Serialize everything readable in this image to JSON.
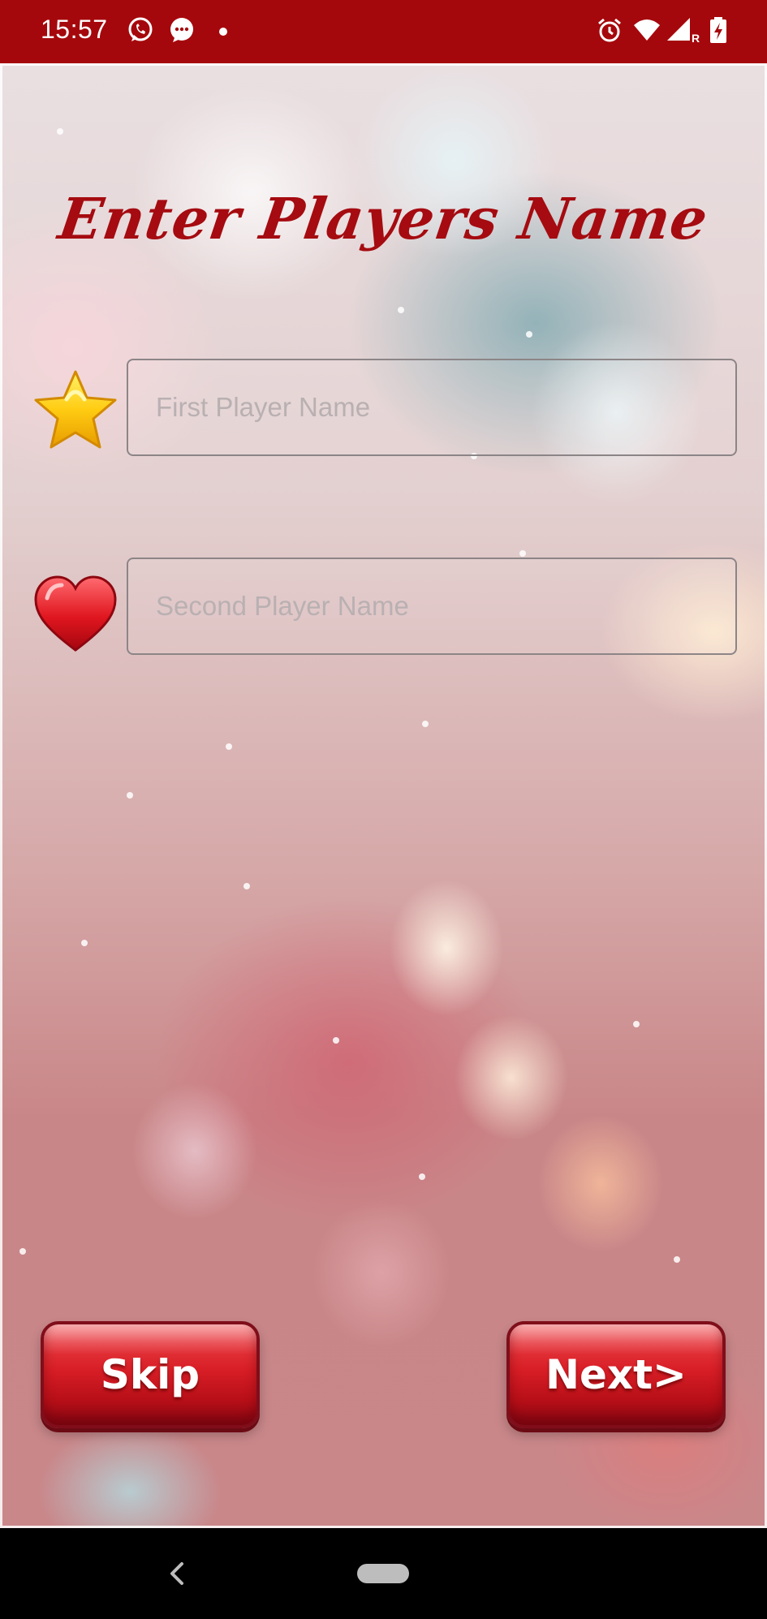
{
  "status_bar": {
    "time": "15:57",
    "left_icons": [
      "whatsapp-icon",
      "message-icon",
      "notification-dot-icon"
    ],
    "right_icons": [
      "alarm-icon",
      "wifi-icon",
      "signal-icon",
      "battery-charging-icon"
    ],
    "signal_label": "R"
  },
  "screen": {
    "title": "Enter Players Name",
    "first_player": {
      "icon": "star-icon",
      "value": "",
      "placeholder": "First Player Name"
    },
    "second_player": {
      "icon": "heart-icon",
      "value": "",
      "placeholder": "Second Player Name"
    },
    "buttons": {
      "skip_label": "Skip",
      "next_label": "Next>"
    }
  },
  "colors": {
    "status_bar": "#a5080c",
    "title": "#a50b10",
    "button": "#d81e26",
    "nav_bar": "#000000"
  },
  "nav_bar": {
    "icons": [
      "back-icon",
      "home-pill-icon"
    ]
  }
}
